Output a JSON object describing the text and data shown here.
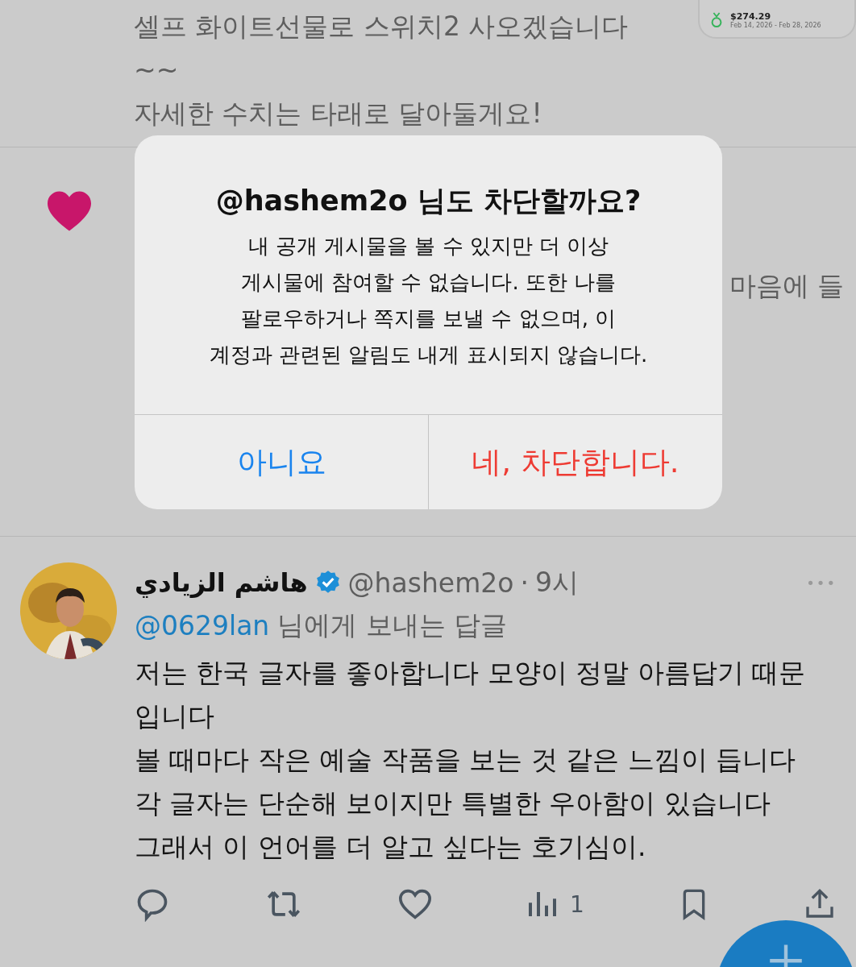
{
  "top_post": {
    "lines": [
      "셀프 화이트선물로 스위치2 사오겠습니다",
      "~~",
      "자세한 수치는 타래로 달아둘게요!"
    ],
    "card": {
      "amount": "$274.29",
      "dates": "Feb 14, 2026 - Feb 28, 2026"
    }
  },
  "hidden_post": {
    "liked": true,
    "partial_text": "마음에 들"
  },
  "dialog": {
    "title": "@hashem2o 님도 차단할까요?",
    "message": "내 공개 게시물을 볼 수 있지만 더 이상\n게시물에 참여할 수 없습니다. 또한 나를\n팔로우하거나 쪽지를 보낼 수 없으며, 이\n계정과 관련된 알림도 내게 표시되지 않습니다.",
    "buttons": [
      {
        "label": "아니요",
        "kind": "cancel"
      },
      {
        "label": "네, 차단합니다.",
        "kind": "destructive"
      }
    ]
  },
  "reply": {
    "name": "هاشم الزيادي",
    "verified": true,
    "handle": "@hashem2o",
    "separator": "·",
    "time": "9시",
    "more": "•••",
    "replying_to": {
      "mention": "@0629lan",
      "text": "님에게 보내는 답글"
    },
    "body": "저는 한국 글자를 좋아합니다 모양이 정말 아름답기 때문입니다\n볼 때마다 작은 예술 작품을 보는 것 같은 느낌이 듭니다\n각 글자는 단순해 보이지만 특별한 우아함이 있습니다\n그래서 이 언어를 더 알고 싶다는 호기심이.",
    "actions": [
      {
        "kind": "reply"
      },
      {
        "kind": "repost"
      },
      {
        "kind": "like"
      },
      {
        "kind": "views",
        "count": "1"
      },
      {
        "kind": "bookmark"
      },
      {
        "kind": "share"
      }
    ]
  }
}
